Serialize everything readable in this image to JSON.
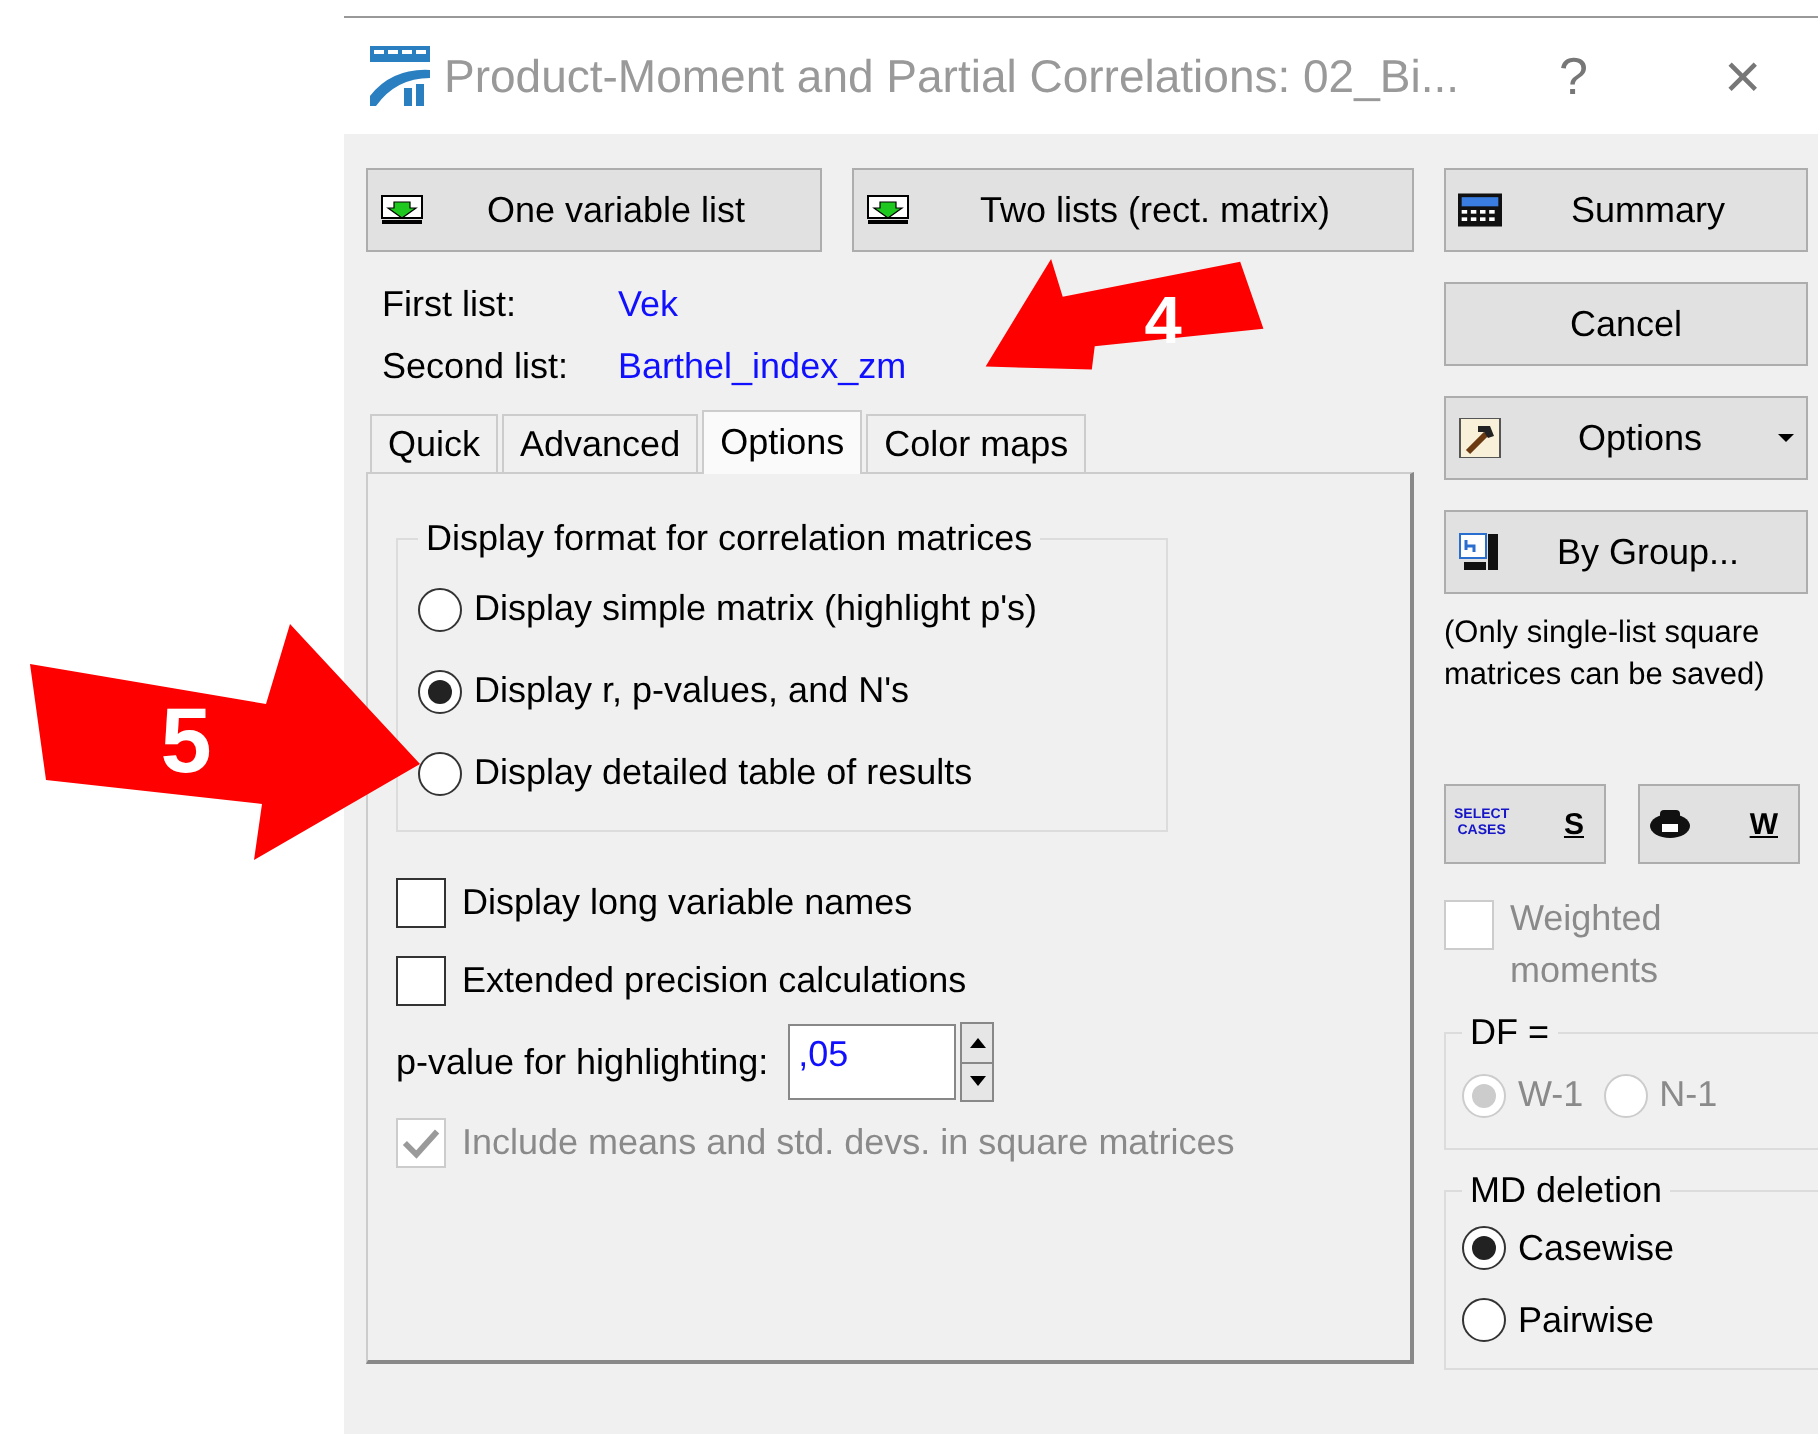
{
  "window": {
    "title": "Product-Moment and Partial Correlations: 02_Bi...",
    "help": "?",
    "close": "×"
  },
  "list_buttons": [
    {
      "label": "One variable list"
    },
    {
      "label": "Two lists (rect. matrix)"
    }
  ],
  "lists": [
    {
      "label": "First list:",
      "value": "Vek"
    },
    {
      "label": "Second list:",
      "value": "Barthel_index_zm"
    }
  ],
  "tabs": [
    {
      "label": "Quick",
      "selected": false
    },
    {
      "label": "Advanced",
      "selected": false
    },
    {
      "label": "Options",
      "selected": true
    },
    {
      "label": "Color maps",
      "selected": false
    }
  ],
  "display_format": {
    "title": "Display format for correlation matrices",
    "options": [
      {
        "label": "Display simple matrix (highlight p's)",
        "selected": false
      },
      {
        "label": "Display r, p-values, and N's",
        "selected": true
      },
      {
        "label": "Display detailed table of results",
        "selected": false
      }
    ]
  },
  "checkboxes": [
    {
      "label": "Display long variable names",
      "checked": false,
      "disabled": false
    },
    {
      "label": "Extended precision calculations",
      "checked": false,
      "disabled": false
    }
  ],
  "p_value": {
    "label": "p-value for highlighting:",
    "value": ",05"
  },
  "include_means": {
    "label": "Include means and std. devs. in square matrices",
    "checked": true,
    "disabled": true
  },
  "side_buttons": [
    {
      "kind": "summary",
      "label": "Summary"
    },
    {
      "kind": "plain",
      "label": "Cancel"
    },
    {
      "kind": "options",
      "label": "Options"
    },
    {
      "kind": "bygroup",
      "label": "By Group..."
    }
  ],
  "note": "(Only single-list square matrices can be saved)",
  "select_cases": {
    "icon_lines": [
      "SELECT",
      "CASES"
    ],
    "label": "S"
  },
  "weight": {
    "label": "W"
  },
  "weighted_moments": {
    "label": "Weighted moments",
    "checked": false,
    "disabled": true
  },
  "df": {
    "title": "DF =",
    "disabled": true,
    "options": [
      {
        "label": "W-1",
        "selected": true
      },
      {
        "label": "N-1",
        "selected": false
      }
    ]
  },
  "md_deletion": {
    "title": "MD deletion",
    "options": [
      {
        "label": "Casewise",
        "selected": true
      },
      {
        "label": "Pairwise",
        "selected": false
      }
    ]
  },
  "annotations": [
    {
      "number": "4"
    },
    {
      "number": "5"
    }
  ]
}
